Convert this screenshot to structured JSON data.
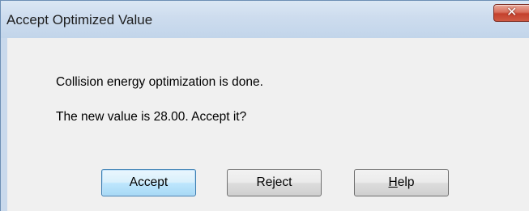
{
  "window": {
    "title": "Accept Optimized Value",
    "close_glyph": "✕"
  },
  "message": {
    "line1": "Collision energy optimization is done.",
    "line2": "The new value is 28.00.  Accept it?"
  },
  "buttons": {
    "accept_label": "Accept",
    "reject_label": "Reject",
    "help_mnemonic": "H",
    "help_rest": "elp"
  },
  "icons": {
    "close": "close-icon"
  },
  "colors": {
    "titlebar": "#c9d9ec",
    "client": "#f0f0f0",
    "close_button": "#c4412d",
    "default_button_border": "#3c7fb1"
  }
}
